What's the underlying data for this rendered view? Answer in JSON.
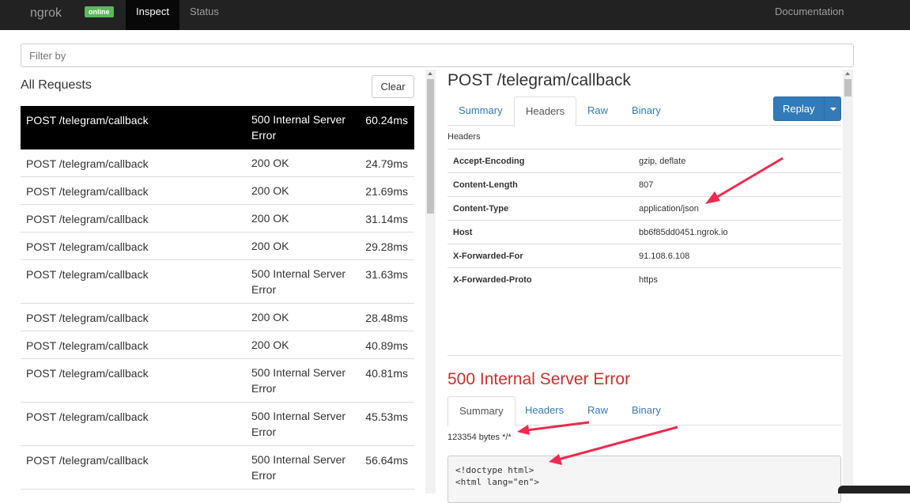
{
  "navbar": {
    "brand": "ngrok",
    "status_badge": "online",
    "tabs": [
      "Inspect",
      "Status"
    ],
    "docs_link": "Documentation"
  },
  "filter": {
    "placeholder": "Filter by"
  },
  "requests": {
    "title": "All Requests",
    "clear_label": "Clear",
    "rows": [
      {
        "path": "POST /telegram/callback",
        "status": "500 Internal Server Error",
        "time": "60.24ms",
        "selected": true
      },
      {
        "path": "POST /telegram/callback",
        "status": "200 OK",
        "time": "24.79ms"
      },
      {
        "path": "POST /telegram/callback",
        "status": "200 OK",
        "time": "21.69ms"
      },
      {
        "path": "POST /telegram/callback",
        "status": "200 OK",
        "time": "31.14ms"
      },
      {
        "path": "POST /telegram/callback",
        "status": "200 OK",
        "time": "29.28ms"
      },
      {
        "path": "POST /telegram/callback",
        "status": "500 Internal Server Error",
        "time": "31.63ms"
      },
      {
        "path": "POST /telegram/callback",
        "status": "200 OK",
        "time": "28.48ms"
      },
      {
        "path": "POST /telegram/callback",
        "status": "200 OK",
        "time": "40.89ms"
      },
      {
        "path": "POST /telegram/callback",
        "status": "500 Internal Server Error",
        "time": "40.81ms"
      },
      {
        "path": "POST /telegram/callback",
        "status": "500 Internal Server Error",
        "time": "45.53ms"
      },
      {
        "path": "POST /telegram/callback",
        "status": "500 Internal Server Error",
        "time": "56.64ms"
      }
    ]
  },
  "request_detail": {
    "title": "POST /telegram/callback",
    "tabs": [
      "Summary",
      "Headers",
      "Raw",
      "Binary"
    ],
    "active_tab": "Headers",
    "replay_label": "Replay",
    "headers_label": "Headers",
    "headers": [
      {
        "key": "Accept-Encoding",
        "value": "gzip, deflate"
      },
      {
        "key": "Content-Length",
        "value": "807"
      },
      {
        "key": "Content-Type",
        "value": "application/json"
      },
      {
        "key": "Host",
        "value": "bb6f85dd0451.ngrok.io"
      },
      {
        "key": "X-Forwarded-For",
        "value": "91.108.6.108"
      },
      {
        "key": "X-Forwarded-Proto",
        "value": "https"
      }
    ]
  },
  "response_detail": {
    "title": "500 Internal Server Error",
    "tabs": [
      "Summary",
      "Headers",
      "Raw",
      "Binary"
    ],
    "active_tab": "Summary",
    "size_text": "123354 bytes */*",
    "body_preview": "<!doctype html>\n<html lang=\"en\">"
  },
  "colors": {
    "navbar_bg": "#222222",
    "badge_green": "#5cb85c",
    "link_blue": "#337ab7",
    "error_red": "#c9302c",
    "annotation_arrow": "#ee2a4f"
  }
}
